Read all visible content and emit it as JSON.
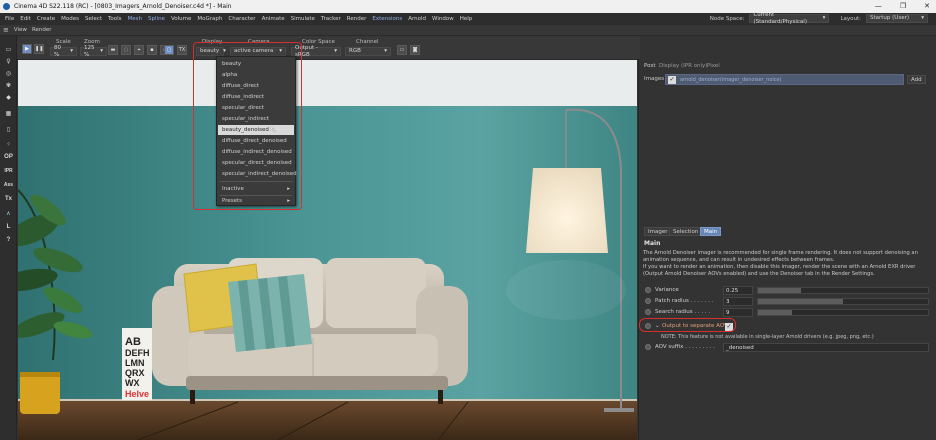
{
  "window": {
    "title": "Cinema 4D S22.118 (RC) - [0803_Imagers_Arnold_Denoiser.c4d *] - Main",
    "buttons": [
      "—",
      "❐",
      "✕"
    ]
  },
  "menubar": {
    "items": [
      "File",
      "Edit",
      "Create",
      "Modes",
      "Select",
      "Tools",
      "Mesh",
      "Spline",
      "Volume",
      "MoGraph",
      "Character",
      "Animate",
      "Simulate",
      "Tracker",
      "Render",
      "Extensions",
      "Arnold",
      "Window",
      "Help"
    ],
    "highlighted": [
      "Mesh",
      "Spline",
      "Extensions"
    ],
    "node_space_label": "Node Space:",
    "node_space_value": "Current (Standard/Physical)",
    "layout_label": "Layout:",
    "layout_value": "Startup (User)"
  },
  "viewbar": {
    "items": [
      "View",
      "Render"
    ]
  },
  "toolbar": {
    "scale_label": "Scale",
    "scale_value": "80 %",
    "zoom_label": "Zoom",
    "zoom_value": "125 %",
    "display_label": "Display",
    "display_value": "beauty",
    "camera_label": "Camera",
    "camera_value": "active camera",
    "color_space_label": "Color Space",
    "color_space_value": "Output - sRGB",
    "channel_label": "Channel",
    "channel_value": "RGB",
    "tx_label": "TX"
  },
  "sidebar": {
    "items": [
      {
        "name": "render-view-icon",
        "glyph": "▭"
      },
      {
        "name": "light-icon",
        "glyph": "♀"
      },
      {
        "name": "sphere-icon",
        "glyph": "◎"
      },
      {
        "name": "nodes-icon",
        "glyph": "✾"
      },
      {
        "name": "shape-icon",
        "glyph": "◆"
      },
      {
        "name": "grid-icon",
        "glyph": "▦"
      },
      {
        "name": "doc-icon",
        "glyph": "▯"
      },
      {
        "name": "dots-icon",
        "glyph": "⁘"
      },
      {
        "name": "op",
        "glyph": "OP"
      },
      {
        "name": "ipr",
        "glyph": "IPR"
      },
      {
        "name": "ass",
        "glyph": "Ass"
      },
      {
        "name": "tx",
        "glyph": "Tx"
      },
      {
        "name": "arnold-icon",
        "glyph": "∧"
      },
      {
        "name": "l",
        "glyph": "L"
      },
      {
        "name": "help",
        "glyph": "?"
      }
    ]
  },
  "dropdown": {
    "items": [
      "beauty",
      "alpha",
      "diffuse_direct",
      "diffuse_indirect",
      "specular_direct",
      "specular_indirect",
      "beauty_denoised",
      "diffuse_direct_denoised",
      "diffuse_indirect_denoised",
      "specular_direct_denoised",
      "specular_indirect_denoised"
    ],
    "selected_index": 6,
    "submenus": [
      "Inactive",
      "Presets"
    ],
    "arrow": "▸"
  },
  "right_panel": {
    "top_tabs": [
      "Post",
      "Display (IPR only)",
      "Pixel"
    ],
    "images_label": "Images",
    "images_value": "arnold_denoiser(imager_denoiser_noice)",
    "add_label": "Add",
    "sub_tabs": [
      "Imager",
      "Selection",
      "Main"
    ],
    "active_sub_tab": "Main",
    "section_title": "Main",
    "description": "The Arnold Denoiser imager is recommended for single frame rendering. It does not support denoising an animation sequence, and can result in undesired effects between frames.\nIf you want to render an animation, then disable this imager, render the scene with an Arnold EXR driver (Output Arnold Denoiser AOVs enabled) and use the Denoiser tab in the Render Settings.",
    "params": [
      {
        "label": "Variance",
        "dots": " ",
        "value": "0.25",
        "fill": 0.25
      },
      {
        "label": "Patch radius",
        "dots": ". . . . . . .",
        "value": "3",
        "fill": 0.5
      },
      {
        "label": "Search radius",
        "dots": ". . . . .",
        "value": "9",
        "fill": 0.2
      }
    ],
    "output_aov_label": "Output to separate AOV",
    "output_aov_checked": "✓",
    "note": "NOTE: This feature is not available in single-layer Arnold drivers (e.g. jpeg, png, etc.)",
    "aov_suffix_label": "AOV suffix",
    "aov_suffix_dots": ". . . . . . . . .",
    "aov_suffix_value": "_denoised"
  },
  "poster": {
    "text": [
      "AB",
      "DEFH",
      "LMN",
      "QRX",
      "WX",
      "Helve"
    ]
  },
  "colors": {
    "wall": "#4a9494",
    "accent_red": "#d3302f",
    "active_tab": "#6786b8"
  }
}
